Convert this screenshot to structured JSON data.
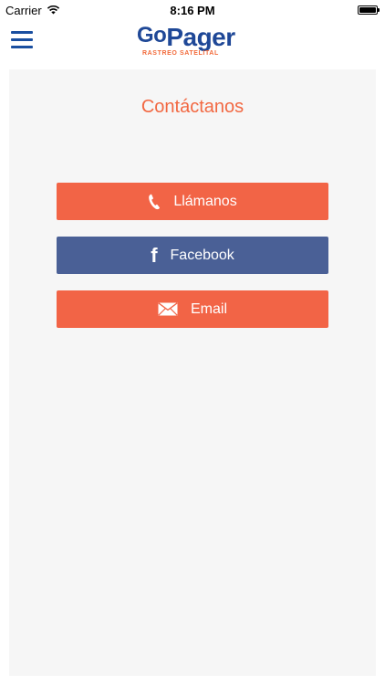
{
  "status_bar": {
    "carrier": "Carrier",
    "time": "8:16 PM",
    "icons": [
      "wifi-icon",
      "battery-icon"
    ]
  },
  "header": {
    "logo": {
      "go": "Go",
      "pager": "Pager",
      "tagline": "RASTREO SATELITAL"
    },
    "menu_icon": "hamburger-menu-icon"
  },
  "main": {
    "title": "Contáctanos",
    "buttons": [
      {
        "label": "Llámanos",
        "icon": "phone-icon",
        "color": "#f26446"
      },
      {
        "label": "Facebook",
        "icon": "facebook-icon",
        "color": "#4a6096"
      },
      {
        "label": "Email",
        "icon": "envelope-icon",
        "color": "#f26446"
      }
    ]
  },
  "colors": {
    "accent": "#f26842",
    "brand_blue": "#1f4897",
    "panel_background": "#f6f6f6"
  }
}
